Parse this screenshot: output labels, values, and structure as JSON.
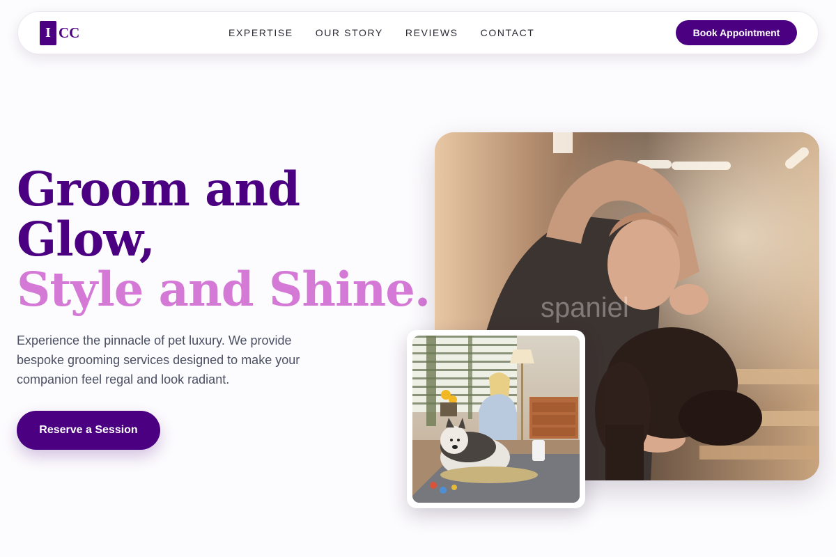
{
  "nav": {
    "logo_mark": "I",
    "logo_text": "CC",
    "links": [
      "EXPERTISE",
      "OUR STORY",
      "REVIEWS",
      "CONTACT"
    ],
    "cta_label": "Book Appointment"
  },
  "hero": {
    "headline_line1": "Groom and",
    "headline_line2": "Glow,",
    "headline_line3": "Style and Shine.",
    "description": "Experience the pinnacle of pet luxury. We provide bespoke grooming services designed to make your companion feel regal and look radiant.",
    "cta_label": "Reserve a Session"
  },
  "images": {
    "main_watermark": "spaniel",
    "main_description_icon": "groomer-trimming-dog-photo",
    "inset_description_icon": "woman-with-husky-photo"
  },
  "colors": {
    "brand_primary": "#4b0082",
    "brand_accent": "#d47ad6",
    "body_text": "#4a4f63",
    "background": "#fcfbfd"
  }
}
